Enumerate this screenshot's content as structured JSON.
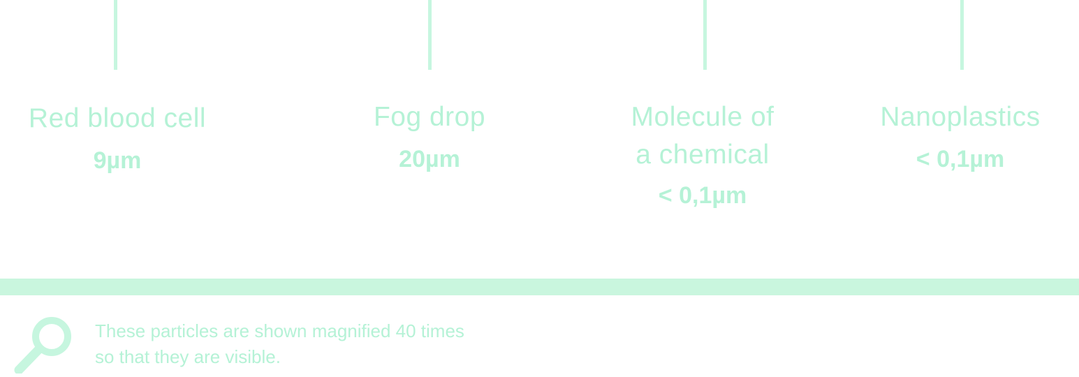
{
  "particles": [
    {
      "name_lines": [
        "Red blood cell"
      ],
      "size": "9µm"
    },
    {
      "name_lines": [
        "Fog drop"
      ],
      "size": "20µm"
    },
    {
      "name_lines": [
        "Molecule of",
        "a chemical"
      ],
      "size": "< 0,1µm"
    },
    {
      "name_lines": [
        "Nanoplastics"
      ],
      "size": "< 0,1µm"
    }
  ],
  "note": {
    "icon": "magnifier-icon",
    "lines": [
      "These particles are shown magnified 40 times",
      "so that they are visible."
    ]
  },
  "colors": {
    "accent": "#c6f6df",
    "text": "#b5f2d6"
  }
}
